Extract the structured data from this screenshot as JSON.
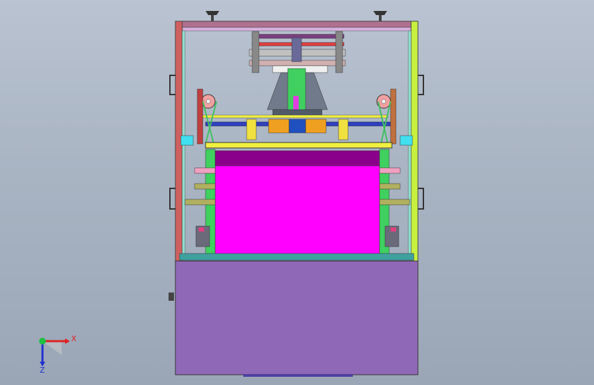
{
  "triad": {
    "x_label": "X",
    "y_label": "Z",
    "x_color": "#e02020",
    "y_color": "#2030d0",
    "origin_color": "#20c040"
  },
  "colors": {
    "background": "#a9b4c3",
    "frame_left": "#d06060",
    "frame_right": "#c8f040",
    "top_bar": "#b07090",
    "base_cabinet": "#9068b8",
    "web_material": "#ff00ff",
    "web_top": "#8a008a",
    "roller_yellow": "#f0f040",
    "shaft_blue": "#3040c0",
    "coupling_orange": "#f0a020",
    "green_part": "#40d060",
    "pink_roller": "#f0a0c0",
    "olive_roller": "#b0b060"
  },
  "icons": [
    "leveling-foot-icon",
    "handle-icon",
    "coordinate-triad-icon"
  ]
}
